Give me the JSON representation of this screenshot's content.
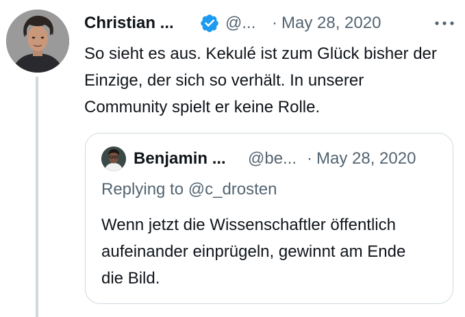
{
  "tweet": {
    "author_name": "Christian ...",
    "handle": "@...",
    "separator": "·",
    "date": "May 28, 2020",
    "text": "So sieht es aus. Kekulé ist zum Glück bisher der Einzige, der sich so verhält. In unserer Community spielt er keine Rolle.",
    "avatar_icon": "profile-photo-icon",
    "verified_icon": "verified-badge-icon",
    "more_icon": "more-options-icon"
  },
  "quoted_tweet": {
    "author_name": "Benjamin ...",
    "handle": "@be...",
    "separator": "·",
    "date": "May 28, 2020",
    "replying_to": "Replying to @c_drosten",
    "text": "Wenn jetzt die Wissenschaftler öffentlich aufeinander einprügeln, gewinnt am Ende die Bild.",
    "avatar_icon": "profile-photo-icon"
  },
  "colors": {
    "text_primary": "#0f1419",
    "text_secondary": "#536471",
    "verified_blue": "#1d9bf0",
    "border": "#cfd9de"
  }
}
